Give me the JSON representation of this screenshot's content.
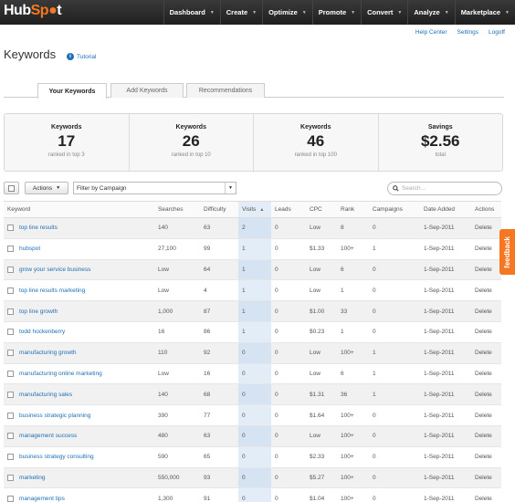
{
  "nav": {
    "logo_part1": "Hub",
    "logo_part2": "Sp",
    "logo_part3": "t",
    "items": [
      {
        "label": "Dashboard"
      },
      {
        "label": "Create"
      },
      {
        "label": "Optimize"
      },
      {
        "label": "Promote"
      },
      {
        "label": "Convert"
      },
      {
        "label": "Analyze"
      },
      {
        "label": "Marketplace"
      }
    ]
  },
  "sublinks": [
    "Help Center",
    "Settings",
    "Logoff"
  ],
  "page": {
    "title": "Keywords",
    "tutorial": "Tutorial"
  },
  "tabs": [
    "Your Keywords",
    "Add Keywords",
    "Recommendations"
  ],
  "stats": [
    {
      "label": "Keywords",
      "value": "17",
      "sub": "ranked in top 3"
    },
    {
      "label": "Keywords",
      "value": "26",
      "sub": "ranked in top 10"
    },
    {
      "label": "Keywords",
      "value": "46",
      "sub": "ranked in top 100"
    },
    {
      "label": "Savings",
      "value": "$2.56",
      "sub": "total"
    }
  ],
  "toolbar": {
    "actions_label": "Actions",
    "filter_value": "Filter by Campaign",
    "search_placeholder": "Search..."
  },
  "table": {
    "columns": [
      "Keyword",
      "Searches",
      "Difficulty",
      "Visits",
      "Leads",
      "CPC",
      "Rank",
      "Campaigns",
      "Date Added",
      "Actions"
    ],
    "rows": [
      {
        "keyword": "top line results",
        "searches": "140",
        "difficulty": "63",
        "visits": "2",
        "leads": "0",
        "cpc": "Low",
        "rank": "8",
        "campaigns": "0",
        "date": "1-Sep-2011",
        "action": "Delete"
      },
      {
        "keyword": "hubspot",
        "searches": "27,100",
        "difficulty": "99",
        "visits": "1",
        "leads": "0",
        "cpc": "$1.33",
        "rank": "100+",
        "campaigns": "1",
        "date": "1-Sep-2011",
        "action": "Delete"
      },
      {
        "keyword": "grow your service business",
        "searches": "Low",
        "difficulty": "64",
        "visits": "1",
        "leads": "0",
        "cpc": "Low",
        "rank": "6",
        "campaigns": "0",
        "date": "1-Sep-2011",
        "action": "Delete"
      },
      {
        "keyword": "top line results marketing",
        "searches": "Low",
        "difficulty": "4",
        "visits": "1",
        "leads": "0",
        "cpc": "Low",
        "rank": "1",
        "campaigns": "0",
        "date": "1-Sep-2011",
        "action": "Delete"
      },
      {
        "keyword": "top line growth",
        "searches": "1,000",
        "difficulty": "87",
        "visits": "1",
        "leads": "0",
        "cpc": "$1.00",
        "rank": "33",
        "campaigns": "0",
        "date": "1-Sep-2011",
        "action": "Delete"
      },
      {
        "keyword": "todd hockenberry",
        "searches": "16",
        "difficulty": "86",
        "visits": "1",
        "leads": "0",
        "cpc": "$0.23",
        "rank": "1",
        "campaigns": "0",
        "date": "1-Sep-2011",
        "action": "Delete"
      },
      {
        "keyword": "manufacturing growth",
        "searches": "110",
        "difficulty": "92",
        "visits": "0",
        "leads": "0",
        "cpc": "Low",
        "rank": "100+",
        "campaigns": "1",
        "date": "1-Sep-2011",
        "action": "Delete"
      },
      {
        "keyword": "manufacturing online marketing",
        "searches": "Low",
        "difficulty": "16",
        "visits": "0",
        "leads": "0",
        "cpc": "Low",
        "rank": "6",
        "campaigns": "1",
        "date": "1-Sep-2011",
        "action": "Delete"
      },
      {
        "keyword": "manufacturing sales",
        "searches": "140",
        "difficulty": "68",
        "visits": "0",
        "leads": "0",
        "cpc": "$1.31",
        "rank": "36",
        "campaigns": "1",
        "date": "1-Sep-2011",
        "action": "Delete"
      },
      {
        "keyword": "business strategic planning",
        "searches": "390",
        "difficulty": "77",
        "visits": "0",
        "leads": "0",
        "cpc": "$1.64",
        "rank": "100+",
        "campaigns": "0",
        "date": "1-Sep-2011",
        "action": "Delete"
      },
      {
        "keyword": "management success",
        "searches": "480",
        "difficulty": "63",
        "visits": "0",
        "leads": "0",
        "cpc": "Low",
        "rank": "100+",
        "campaigns": "0",
        "date": "1-Sep-2011",
        "action": "Delete"
      },
      {
        "keyword": "business strategy consulting",
        "searches": "590",
        "difficulty": "65",
        "visits": "0",
        "leads": "0",
        "cpc": "$2.33",
        "rank": "100+",
        "campaigns": "0",
        "date": "1-Sep-2011",
        "action": "Delete"
      },
      {
        "keyword": "marketing",
        "searches": "550,000",
        "difficulty": "93",
        "visits": "0",
        "leads": "0",
        "cpc": "$5.27",
        "rank": "100+",
        "campaigns": "0",
        "date": "1-Sep-2011",
        "action": "Delete"
      },
      {
        "keyword": "management tips",
        "searches": "1,300",
        "difficulty": "91",
        "visits": "0",
        "leads": "0",
        "cpc": "$1.04",
        "rank": "100+",
        "campaigns": "0",
        "date": "1-Sep-2011",
        "action": "Delete"
      }
    ]
  },
  "feedback_label": "feedback",
  "colors": {
    "nav_bg": "#2b2b2b",
    "accent": "#f57722",
    "link": "#1f6fb5"
  }
}
